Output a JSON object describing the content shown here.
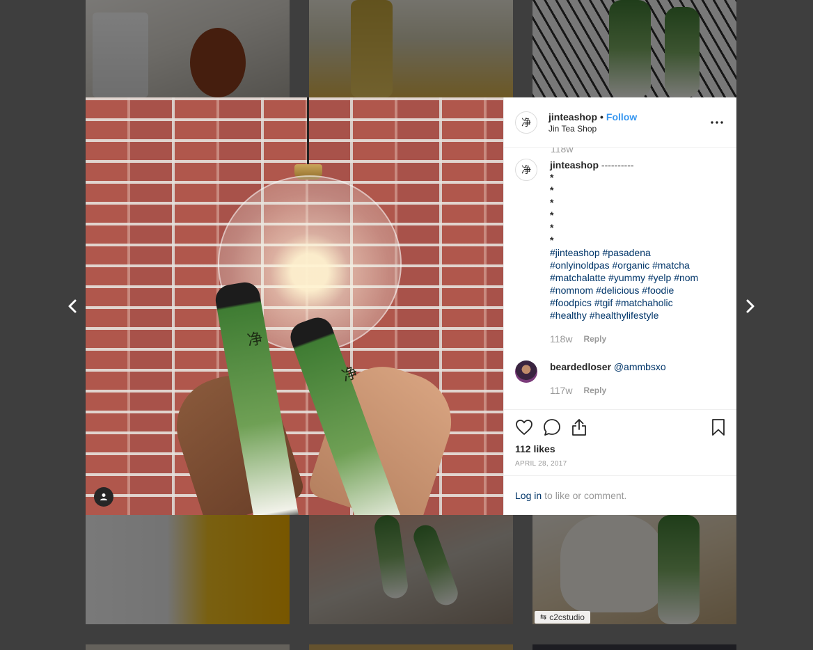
{
  "post": {
    "username": "jinteashop",
    "separator": "•",
    "follow_label": "Follow",
    "location": "Jin Tea Shop",
    "more_label": "•••",
    "avatar_glyph": "净",
    "date": "APRIL 28, 2017",
    "likes": "112 likes"
  },
  "comments": {
    "partial_time": "118w",
    "caption": {
      "username": "jinteashop",
      "first_line": " ----------",
      "asterisks": [
        "*",
        "*",
        "*",
        "*",
        "*",
        "*"
      ],
      "hashtags": [
        "#jinteashop #pasadena",
        "#onlyinoldpas #organic #matcha",
        "#matchalatte #yummy #yelp #nom",
        "#nomnom #delicious #foodie",
        "#foodpics #tgif #matchaholic",
        "#healthy #healthylifestyle"
      ],
      "time": "118w",
      "reply_label": "Reply"
    },
    "reply": {
      "username": "beardedloser",
      "mention": "@ammbsxo",
      "time": "117w",
      "reply_label": "Reply"
    }
  },
  "login": {
    "link_label": "Log in",
    "suffix": "to like or comment."
  },
  "background": {
    "watermark": "c2cstudio"
  },
  "icons": {
    "prev": "chevron-left-icon",
    "next": "chevron-right-icon",
    "like": "heart-icon",
    "comment": "comment-icon",
    "share": "share-icon",
    "save": "bookmark-icon",
    "user_tag": "user-icon"
  }
}
